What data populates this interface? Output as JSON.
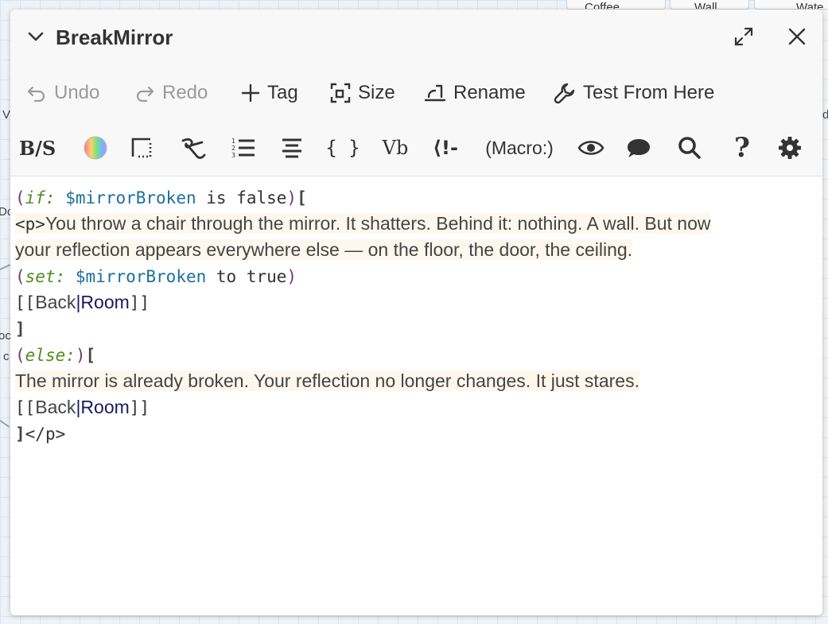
{
  "background": {
    "cards": [
      "Coffee",
      "Wall",
      "Wate"
    ],
    "fragments": [
      "V",
      "d",
      "Do",
      "oc",
      "c"
    ]
  },
  "dialog": {
    "title": "BreakMirror",
    "icons": {
      "collapse": "chevron-down-icon",
      "maximize": "maximize-icon",
      "close": "close-icon"
    }
  },
  "toolbar": {
    "undo": "Undo",
    "redo": "Redo",
    "tag": "Tag",
    "size": "Size",
    "rename": "Rename",
    "test_from_here": "Test From Here"
  },
  "format_toolbar": {
    "bs": "B/S",
    "vb": "Vb",
    "braces": "{ }",
    "comment": "⟨!-",
    "macro": "(Macro:)",
    "question": "?"
  },
  "code": {
    "l1": {
      "open": "(",
      "macro": "if:",
      "var": "$mirrorBroken",
      "rest": " is false",
      "close": ")",
      "bracket": "["
    },
    "l2": {
      "tag": "<p>",
      "text": "You throw a chair through the mirror. It shatters. Behind it: nothing. A wall. But now"
    },
    "l3": {
      "text": "your reflection appears everywhere else — on the floor, the door, the ceiling."
    },
    "l4": {
      "open": "(",
      "macro": "set:",
      "var": "$mirrorBroken",
      "rest": " to true",
      "close": ")"
    },
    "l5": {
      "open": "[[",
      "label": "Back",
      "sep": "|",
      "target": "Room",
      "close": "]]"
    },
    "l6": {
      "bracket": "]"
    },
    "l7": {
      "open": "(",
      "macro": "else:",
      "close": ")",
      "bracket": "["
    },
    "l8": {
      "text": "The mirror is already broken. Your reflection no longer changes. It just stares."
    },
    "l9": {
      "open": "[[",
      "label": "Back",
      "sep": "|",
      "target": "Room",
      "close": "]]"
    },
    "l10": {
      "bracket": "]",
      "tag": "</p>"
    }
  }
}
